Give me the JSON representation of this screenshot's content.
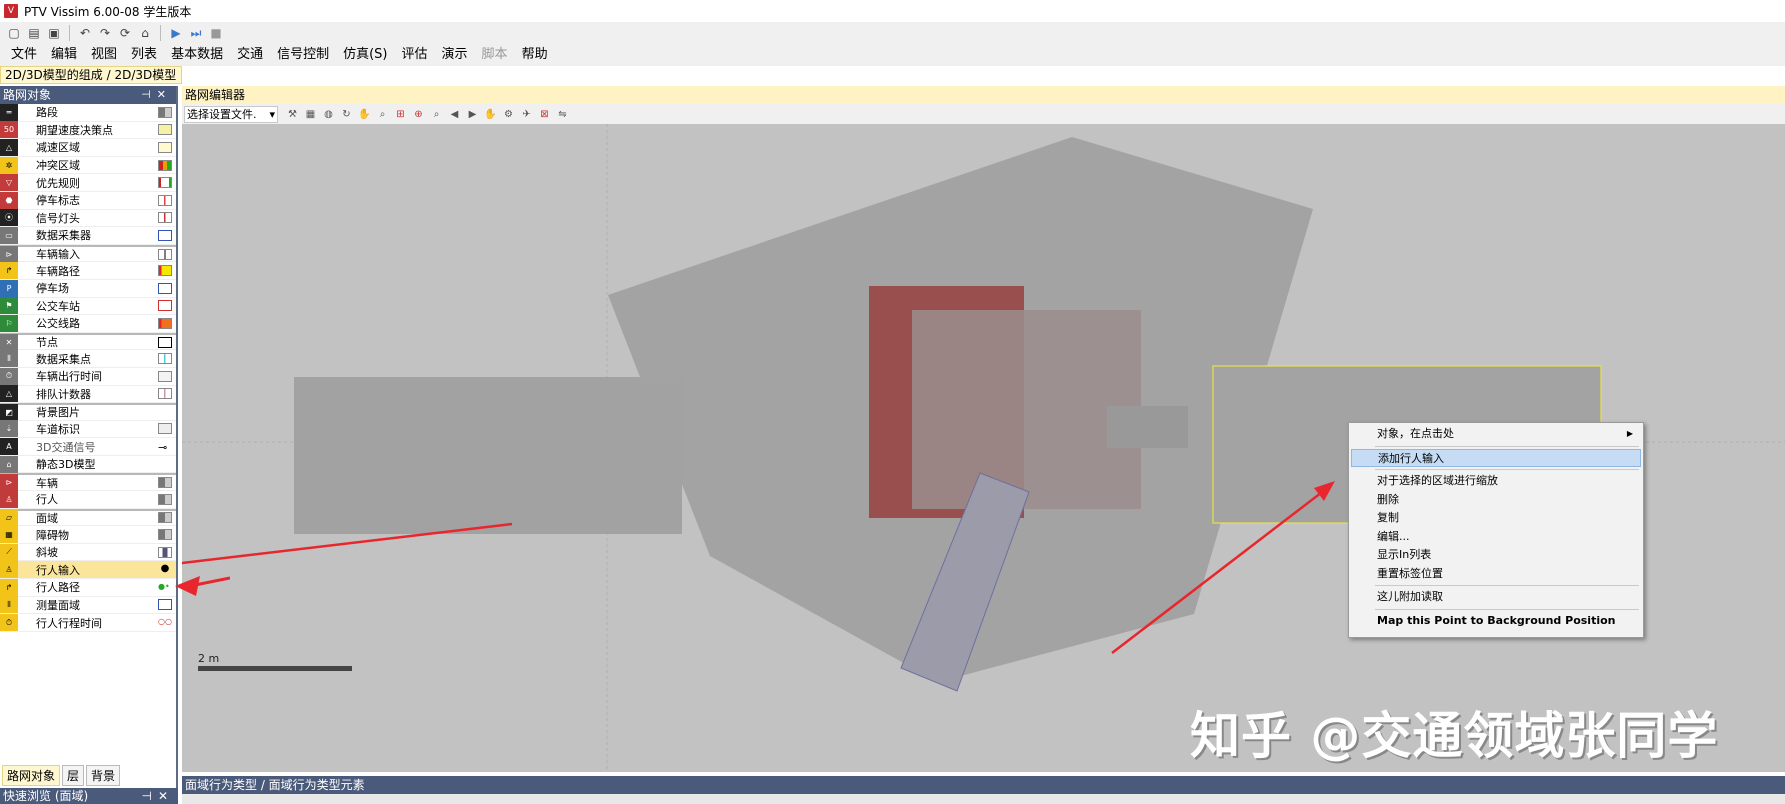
{
  "window": {
    "title": "PTV Vissim 6.00-08 学生版本",
    "app_icon": "vissim-icon"
  },
  "quick_access": [
    "new-icon",
    "open-icon",
    "save-icon",
    "undo-icon",
    "redo-icon",
    "refresh-icon",
    "home-icon",
    "play-icon",
    "step-icon",
    "stop-icon"
  ],
  "menu": [
    {
      "label": "文件",
      "enabled": true
    },
    {
      "label": "编辑",
      "enabled": true
    },
    {
      "label": "视图",
      "enabled": true
    },
    {
      "label": "列表",
      "enabled": true
    },
    {
      "label": "基本数据",
      "enabled": true
    },
    {
      "label": "交通",
      "enabled": true
    },
    {
      "label": "信号控制",
      "enabled": true
    },
    {
      "label": "仿真(S)",
      "enabled": true
    },
    {
      "label": "评估",
      "enabled": true
    },
    {
      "label": "演示",
      "enabled": true
    },
    {
      "label": "脚本",
      "enabled": false
    },
    {
      "label": "帮助",
      "enabled": true
    }
  ],
  "layout_path": "2D/3D模型的组成 / 2D/3D模型",
  "left_panel": {
    "title": "路网对象",
    "items": [
      {
        "label": "路段"
      },
      {
        "label": "期望速度决策点"
      },
      {
        "label": "减速区域"
      },
      {
        "label": "冲突区域"
      },
      {
        "label": "优先规则"
      },
      {
        "label": "停车标志"
      },
      {
        "label": "信号灯头"
      },
      {
        "label": "数据采集器"
      },
      {
        "label": "车辆输入"
      },
      {
        "label": "车辆路径"
      },
      {
        "label": "停车场"
      },
      {
        "label": "公交车站"
      },
      {
        "label": "公交线路"
      },
      {
        "label": "节点"
      },
      {
        "label": "数据采集点"
      },
      {
        "label": "车辆出行时间"
      },
      {
        "label": "排队计数器"
      },
      {
        "label": "背景图片"
      },
      {
        "label": "车道标识"
      },
      {
        "label": "3D交通信号"
      },
      {
        "label": "静态3D模型"
      },
      {
        "label": "车辆"
      },
      {
        "label": "行人"
      },
      {
        "label": "面域"
      },
      {
        "label": "障碍物"
      },
      {
        "label": "斜坡"
      },
      {
        "label": "行人输入"
      },
      {
        "label": "行人路径"
      },
      {
        "label": "测量面域"
      },
      {
        "label": "行人行程时间"
      }
    ],
    "tabs": [
      "路网对象",
      "层",
      "背景"
    ],
    "quick_view_title": "快速浏览 (面域)"
  },
  "editor": {
    "title": "路网编辑器",
    "combo_label": "选择设置文件."
  },
  "context_menu": {
    "items": [
      {
        "label": "对象，在点击处",
        "submenu": true
      },
      {
        "label": "添加行人输入",
        "highlight": true
      },
      {
        "label": "对于选择的区域进行缩放"
      },
      {
        "label": "删除"
      },
      {
        "label": "复制"
      },
      {
        "label": "编辑..."
      },
      {
        "label": "显示In列表"
      },
      {
        "label": "重置标签位置"
      },
      {
        "label": "这儿附加读取"
      },
      {
        "label": "Map this Point to Background Position"
      }
    ]
  },
  "scale_label": "2 m",
  "watermark": "知乎 @交通领域张同学",
  "bottom_panel": {
    "title": "面域行为类型 / 面域行为类型元素"
  }
}
